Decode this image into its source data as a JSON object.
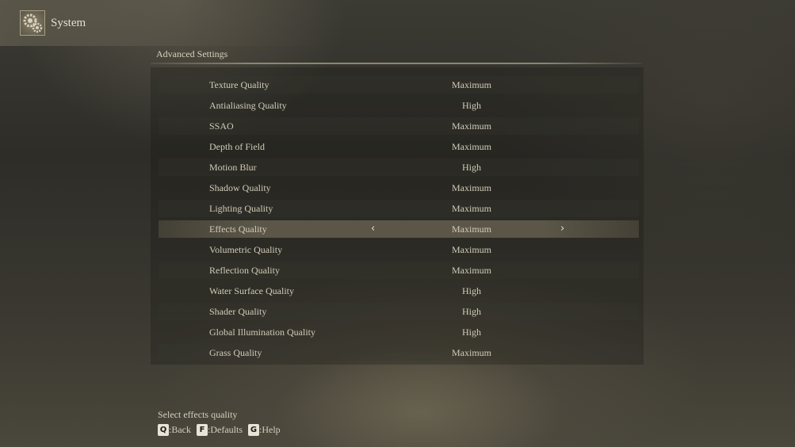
{
  "header": {
    "title": "System",
    "icon": "gears-icon"
  },
  "section": {
    "title": "Advanced Settings"
  },
  "settings": [
    {
      "label": "Texture Quality",
      "value": "Maximum"
    },
    {
      "label": "Antialiasing Quality",
      "value": "High"
    },
    {
      "label": "SSAO",
      "value": "Maximum"
    },
    {
      "label": "Depth of Field",
      "value": "Maximum"
    },
    {
      "label": "Motion Blur",
      "value": "High"
    },
    {
      "label": "Shadow Quality",
      "value": "Maximum"
    },
    {
      "label": "Lighting Quality",
      "value": "Maximum"
    },
    {
      "label": "Effects Quality",
      "value": "Maximum",
      "selected": true
    },
    {
      "label": "Volumetric Quality",
      "value": "Maximum"
    },
    {
      "label": "Reflection Quality",
      "value": "Maximum"
    },
    {
      "label": "Water Surface Quality",
      "value": "High"
    },
    {
      "label": "Shader Quality",
      "value": "High"
    },
    {
      "label": "Global Illumination Quality",
      "value": "High"
    },
    {
      "label": "Grass Quality",
      "value": "Maximum"
    }
  ],
  "arrows": {
    "left": "‹",
    "right": "›"
  },
  "footer": {
    "help": "Select effects quality",
    "keys": [
      {
        "key": "Q",
        "action": ":Back"
      },
      {
        "key": "F",
        "action": ":Defaults"
      },
      {
        "key": "G",
        "action": ":Help"
      }
    ]
  }
}
